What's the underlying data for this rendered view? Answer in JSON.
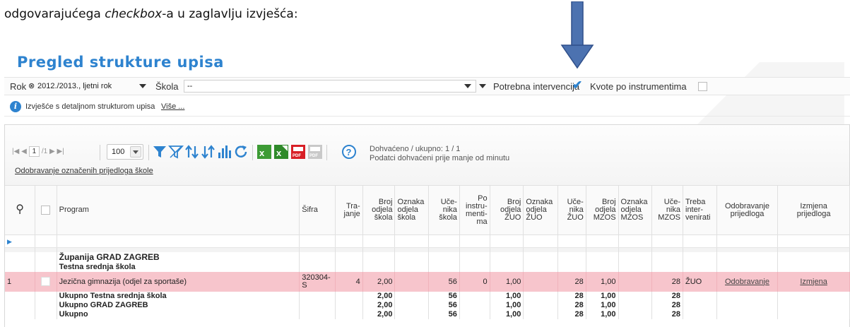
{
  "doc": {
    "text_before": "odgovarajućega ",
    "text_italic": "checkbox",
    "text_after": "-a u zaglavlju izvješća:"
  },
  "colors": {
    "accent": "#2e83cf",
    "arrow": "#4c72b0",
    "row_highlight": "#f7c5cc"
  },
  "page": {
    "title": "Pregled strukture upisa"
  },
  "filters": {
    "rok_label": "Rok",
    "rok_value": "2012./2013., ljetni rok",
    "skola_label": "Škola",
    "skola_value": "--",
    "potrebna_label": "Potrebna intervencija",
    "potrebna_checked": true,
    "kvote_label": "Kvote po instrumentima",
    "kvote_checked": false
  },
  "info": {
    "text": "Izvješće s detaljnom strukturom upisa",
    "more": "Više ..."
  },
  "toolbar": {
    "page_current": "1",
    "page_total": "/1",
    "page_size": "100",
    "fetched_line1": "Dohvaćeno / ukupno: 1 / 1",
    "fetched_line2": "Podatci dohvaćeni prije manje od minutu",
    "approve_selected": "Odobravanje označenih prijedloga škole",
    "icons": [
      "filter-icon",
      "clear-filter-icon",
      "sort-icon",
      "sort-desc-icon",
      "chart-icon",
      "refresh-icon",
      "excel-icon",
      "excel-export-icon",
      "pdf-icon",
      "pdf-disabled-icon",
      "help-icon"
    ]
  },
  "columns": {
    "program": "Program",
    "sifra": "Šifra",
    "trajanje_1": "Tra-",
    "trajanje_2": "janje",
    "broj_skola_1": "Broj",
    "broj_skola_2": "odjela",
    "broj_skola_3": "škola",
    "oznaka_skola_1": "Oznaka",
    "oznaka_skola_2": "odjela",
    "oznaka_skola_3": "škola",
    "ucenika_skola_1": "Uče-",
    "ucenika_skola_2": "nika",
    "ucenika_skola_3": "škola",
    "po_instr_1": "Po",
    "po_instr_2": "instru-",
    "po_instr_3": "menti-",
    "po_instr_4": "ma",
    "broj_zuo_1": "Broj",
    "broj_zuo_2": "odjela",
    "broj_zuo_3": "ŽUO",
    "oznaka_zuo_1": "Oznaka",
    "oznaka_zuo_2": "odjela",
    "oznaka_zuo_3": "ŽUO",
    "ucenika_zuo_1": "Uče-",
    "ucenika_zuo_2": "nika",
    "ucenika_zuo_3": "ŽUO",
    "broj_mzos_1": "Broj",
    "broj_mzos_2": "odjela",
    "broj_mzos_3": "MZOS",
    "oznaka_mzos_1": "Oznaka",
    "oznaka_mzos_2": "odjela",
    "oznaka_mzos_3": "MZOS",
    "ucenika_mzos_1": "Uče-",
    "ucenika_mzos_2": "nika",
    "ucenika_mzos_3": "MZOS",
    "treba_1": "Treba",
    "treba_2": "inter-",
    "treba_3": "venirati",
    "odobravanje_1": "Odobravanje",
    "odobravanje_2": "prijedloga",
    "izmjena_1": "Izmjena",
    "izmjena_2": "prijedloga"
  },
  "groups": {
    "zupanija": "Županija GRAD ZAGREB",
    "skola": "Testna srednja škola"
  },
  "row": {
    "num": "1",
    "program": "Jezična gimnazija (odjel za sportaše)",
    "sifra_1": "320304-",
    "sifra_2": "S",
    "trajanje": "4",
    "broj_skola": "2,00",
    "ucenika_skola": "56",
    "po_instrumentima": "0",
    "broj_zuo": "1,00",
    "ucenika_zuo": "28",
    "broj_mzos": "1,00",
    "ucenika_mzos": "28",
    "treba": "ŽUO",
    "odobravanje": "Odobravanje",
    "izmjena": "Izmjena"
  },
  "totals": [
    {
      "label": "Ukupno Testna srednja škola",
      "broj_skola": "2,00",
      "ucenika_skola": "56",
      "broj_zuo": "1,00",
      "ucenika_zuo": "28",
      "broj_mzos": "1,00",
      "ucenika_mzos": "28"
    },
    {
      "label": "Ukupno GRAD ZAGREB",
      "broj_skola": "2,00",
      "ucenika_skola": "56",
      "broj_zuo": "1,00",
      "ucenika_zuo": "28",
      "broj_mzos": "1,00",
      "ucenika_mzos": "28"
    },
    {
      "label": "Ukupno",
      "broj_skola": "2,00",
      "ucenika_skola": "56",
      "broj_zuo": "1,00",
      "ucenika_zuo": "28",
      "broj_mzos": "1,00",
      "ucenika_mzos": "28"
    }
  ]
}
